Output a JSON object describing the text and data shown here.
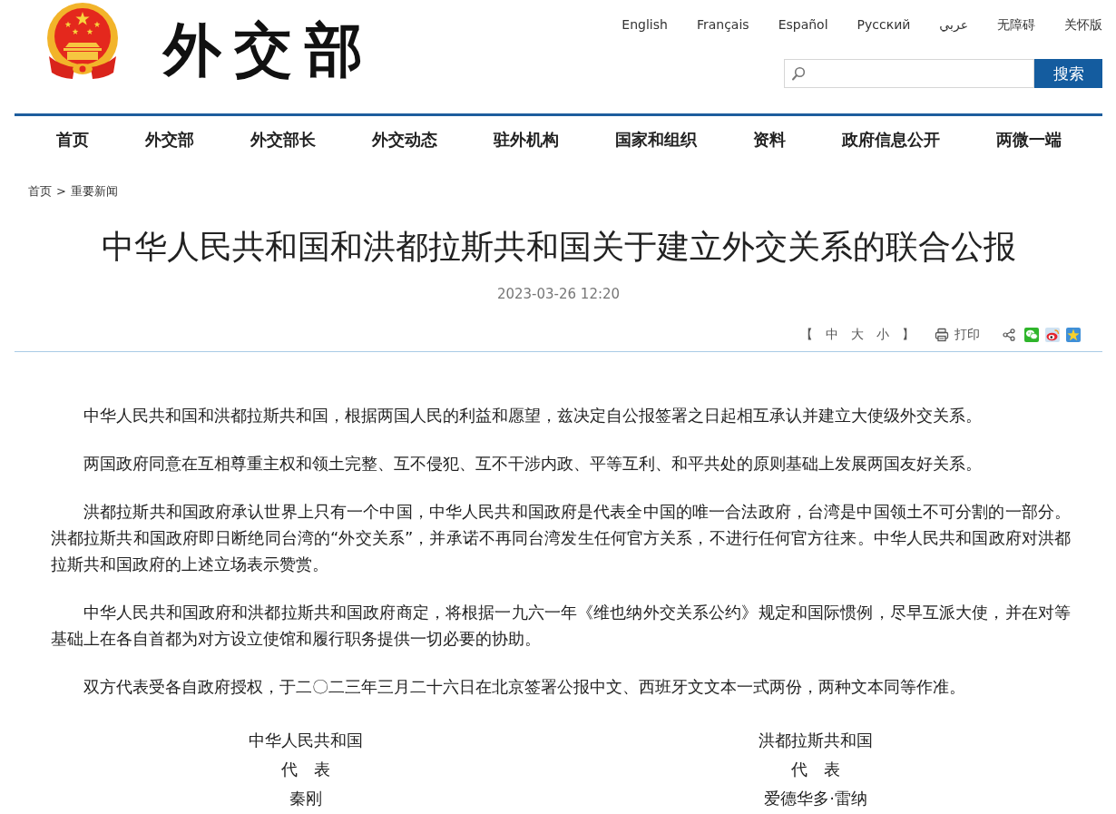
{
  "header": {
    "logo_text": "外交部",
    "languages": [
      "English",
      "Français",
      "Español",
      "Русский",
      "عربي",
      "无障碍",
      "关怀版"
    ],
    "search": {
      "button": "搜索"
    }
  },
  "nav": [
    "首页",
    "外交部",
    "外交部长",
    "外交动态",
    "驻外机构",
    "国家和组织",
    "资料",
    "政府信息公开",
    "两微一端"
  ],
  "breadcrumb": {
    "links": [
      "首页",
      "重要新闻"
    ],
    "separator": ">"
  },
  "article": {
    "title": "中华人民共和国和洪都拉斯共和国关于建立外交关系的联合公报",
    "date": "2023-03-26 12:20",
    "tools": {
      "bracket_open": "【",
      "font_sizes": [
        "中",
        "大",
        "小"
      ],
      "bracket_close": "】",
      "print": "打印"
    },
    "paragraphs": [
      "中华人民共和国和洪都拉斯共和国，根据两国人民的利益和愿望，兹决定自公报签署之日起相互承认并建立大使级外交关系。",
      "两国政府同意在互相尊重主权和领土完整、互不侵犯、互不干涉内政、平等互利、和平共处的原则基础上发展两国友好关系。",
      "洪都拉斯共和国政府承认世界上只有一个中国，中华人民共和国政府是代表全中国的唯一合法政府，台湾是中国领土不可分割的一部分。洪都拉斯共和国政府即日断绝同台湾的“外交关系”，并承诺不再同台湾发生任何官方关系，不进行任何官方往来。中华人民共和国政府对洪都拉斯共和国政府的上述立场表示赞赏。",
      "中华人民共和国政府和洪都拉斯共和国政府商定，将根据一九六一年《维也纳外交关系公约》规定和国际惯例，尽早互派大使，并在对等基础上在各自首都为对方设立使馆和履行职务提供一切必要的协助。",
      "双方代表受各自政府授权，于二〇二三年三月二十六日在北京签署公报中文、西班牙文文本一式两份，两种文本同等作准。"
    ],
    "signatures": [
      {
        "country": "中华人民共和国",
        "role": "代　表",
        "name": "秦刚"
      },
      {
        "country": "洪都拉斯共和国",
        "role": "代　表",
        "name": "爱德华多·雷纳"
      }
    ]
  }
}
